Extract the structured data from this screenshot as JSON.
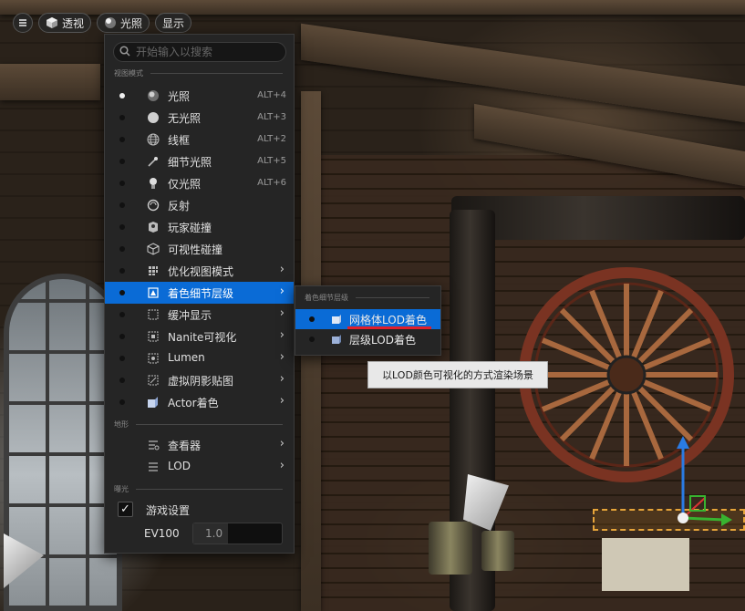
{
  "toolbar": {
    "menu_icon": "hamburger-icon",
    "perspective_label": "透视",
    "lighting_label": "光照",
    "show_label": "显示"
  },
  "search": {
    "placeholder": "开始输入以搜索"
  },
  "menu": {
    "sections": {
      "view_mode": "视图模式",
      "landscape": "地形",
      "exposure": "曝光"
    },
    "items": [
      {
        "label": "光照",
        "shortcut": "ALT+4",
        "icon": "lit-icon",
        "selected": true
      },
      {
        "label": "无光照",
        "shortcut": "ALT+3",
        "icon": "unlit-icon"
      },
      {
        "label": "线框",
        "shortcut": "ALT+2",
        "icon": "wireframe-icon"
      },
      {
        "label": "细节光照",
        "shortcut": "ALT+5",
        "icon": "detail-lighting-icon"
      },
      {
        "label": "仅光照",
        "shortcut": "ALT+6",
        "icon": "lighting-only-icon"
      },
      {
        "label": "反射",
        "icon": "reflection-icon"
      },
      {
        "label": "玩家碰撞",
        "icon": "player-collision-icon"
      },
      {
        "label": "可视性碰撞",
        "icon": "visibility-collision-icon"
      },
      {
        "label": "优化视图模式",
        "icon": "optimization-icon",
        "submenu": true
      },
      {
        "label": "着色细节层级",
        "icon": "lod-coloration-icon",
        "submenu": true,
        "active": true
      },
      {
        "label": "缓冲显示",
        "icon": "buffer-icon",
        "submenu": true
      },
      {
        "label": "Nanite可视化",
        "icon": "nanite-icon",
        "submenu": true
      },
      {
        "label": "Lumen",
        "icon": "lumen-icon",
        "submenu": true
      },
      {
        "label": "虚拟阴影贴图",
        "icon": "virtual-shadow-icon",
        "submenu": true
      },
      {
        "label": "Actor着色",
        "icon": "actor-coloration-icon",
        "submenu": true
      }
    ],
    "landscape_items": [
      {
        "label": "查看器",
        "icon": "viewer-icon",
        "submenu": true
      },
      {
        "label": "LOD",
        "icon": "lod-icon",
        "submenu": true
      }
    ],
    "exposure": {
      "game_settings_label": "游戏设置",
      "game_settings_checked": true,
      "ev100_label": "EV100",
      "ev100_value": "1.0"
    }
  },
  "submenu": {
    "section": "着色细节层级",
    "items": [
      {
        "label": "网格体LOD着色",
        "icon": "mesh-lod-icon",
        "active": true
      },
      {
        "label": "层级LOD着色",
        "icon": "hierarchical-lod-icon"
      }
    ]
  },
  "tooltip": {
    "text": "以LOD颜色可视化的方式渲染场景"
  },
  "colors": {
    "accent": "#0a6bd6",
    "menu_bg": "#252525",
    "highlight_underline": "#e0202a"
  }
}
